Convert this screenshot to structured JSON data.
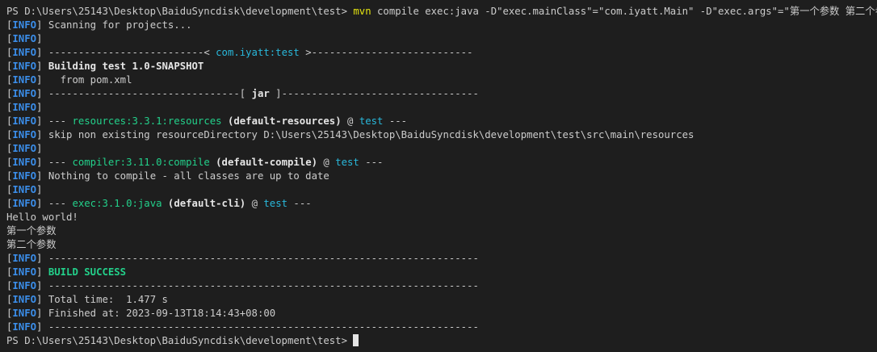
{
  "colors": {
    "background": "#1e1e1e",
    "text": "#cccccc",
    "info_tag": "#3b8eea",
    "command": "#e5e510",
    "artifact": "#29b8db",
    "plugin": "#23d18b",
    "success": "#23d18b",
    "cursor": "#e5e5e5"
  },
  "lines": [
    [
      {
        "t": "PS D:\\Users\\25143\\Desktop\\BaiduSyncdisk\\development\\test> ",
        "c": "white"
      },
      {
        "t": "mvn",
        "c": "yellow"
      },
      {
        "t": " compile exec:java -D\"exec.mainClass\"=\"com.iyatt.Main\" -D\"exec.args\"=\"第一个参数 第二个参数\"",
        "c": "white"
      }
    ],
    [
      {
        "t": "[",
        "c": "bracket"
      },
      {
        "t": "INFO",
        "c": "blue"
      },
      {
        "t": "] Scanning for projects...",
        "c": "white"
      }
    ],
    [
      {
        "t": "[",
        "c": "bracket"
      },
      {
        "t": "INFO",
        "c": "blue"
      },
      {
        "t": "]",
        "c": "white"
      }
    ],
    [
      {
        "t": "[",
        "c": "bracket"
      },
      {
        "t": "INFO",
        "c": "blue"
      },
      {
        "t": "] --------------------------< ",
        "c": "white"
      },
      {
        "t": "com.iyatt:test",
        "c": "cyan"
      },
      {
        "t": " >---------------------------",
        "c": "white"
      }
    ],
    [
      {
        "t": "[",
        "c": "bracket"
      },
      {
        "t": "INFO",
        "c": "blue"
      },
      {
        "t": "] ",
        "c": "white"
      },
      {
        "t": "Building test 1.0-SNAPSHOT",
        "c": "bold"
      }
    ],
    [
      {
        "t": "[",
        "c": "bracket"
      },
      {
        "t": "INFO",
        "c": "blue"
      },
      {
        "t": "]   from pom.xml",
        "c": "white"
      }
    ],
    [
      {
        "t": "[",
        "c": "bracket"
      },
      {
        "t": "INFO",
        "c": "blue"
      },
      {
        "t": "] --------------------------------[ ",
        "c": "white"
      },
      {
        "t": "jar",
        "c": "bold"
      },
      {
        "t": " ]---------------------------------",
        "c": "white"
      }
    ],
    [
      {
        "t": "[",
        "c": "bracket"
      },
      {
        "t": "INFO",
        "c": "blue"
      },
      {
        "t": "]",
        "c": "white"
      }
    ],
    [
      {
        "t": "[",
        "c": "bracket"
      },
      {
        "t": "INFO",
        "c": "blue"
      },
      {
        "t": "] --- ",
        "c": "white"
      },
      {
        "t": "resources:3.3.1:resources",
        "c": "green"
      },
      {
        "t": " ",
        "c": "white"
      },
      {
        "t": "(default-resources)",
        "c": "bold"
      },
      {
        "t": " @ ",
        "c": "white"
      },
      {
        "t": "test",
        "c": "cyan"
      },
      {
        "t": " ---",
        "c": "white"
      }
    ],
    [
      {
        "t": "[",
        "c": "bracket"
      },
      {
        "t": "INFO",
        "c": "blue"
      },
      {
        "t": "] skip non existing resourceDirectory D:\\Users\\25143\\Desktop\\BaiduSyncdisk\\development\\test\\src\\main\\resources",
        "c": "white"
      }
    ],
    [
      {
        "t": "[",
        "c": "bracket"
      },
      {
        "t": "INFO",
        "c": "blue"
      },
      {
        "t": "]",
        "c": "white"
      }
    ],
    [
      {
        "t": "[",
        "c": "bracket"
      },
      {
        "t": "INFO",
        "c": "blue"
      },
      {
        "t": "] --- ",
        "c": "white"
      },
      {
        "t": "compiler:3.11.0:compile",
        "c": "green"
      },
      {
        "t": " ",
        "c": "white"
      },
      {
        "t": "(default-compile)",
        "c": "bold"
      },
      {
        "t": " @ ",
        "c": "white"
      },
      {
        "t": "test",
        "c": "cyan"
      },
      {
        "t": " ---",
        "c": "white"
      }
    ],
    [
      {
        "t": "[",
        "c": "bracket"
      },
      {
        "t": "INFO",
        "c": "blue"
      },
      {
        "t": "] Nothing to compile - all classes are up to date",
        "c": "white"
      }
    ],
    [
      {
        "t": "[",
        "c": "bracket"
      },
      {
        "t": "INFO",
        "c": "blue"
      },
      {
        "t": "]",
        "c": "white"
      }
    ],
    [
      {
        "t": "[",
        "c": "bracket"
      },
      {
        "t": "INFO",
        "c": "blue"
      },
      {
        "t": "] --- ",
        "c": "white"
      },
      {
        "t": "exec:3.1.0:java",
        "c": "green"
      },
      {
        "t": " ",
        "c": "white"
      },
      {
        "t": "(default-cli)",
        "c": "bold"
      },
      {
        "t": " @ ",
        "c": "white"
      },
      {
        "t": "test",
        "c": "cyan"
      },
      {
        "t": " ---",
        "c": "white"
      }
    ],
    [
      {
        "t": "Hello world!",
        "c": "white"
      }
    ],
    [
      {
        "t": "第一个参数",
        "c": "white"
      }
    ],
    [
      {
        "t": "第二个参数",
        "c": "white"
      }
    ],
    [
      {
        "t": "[",
        "c": "bracket"
      },
      {
        "t": "INFO",
        "c": "blue"
      },
      {
        "t": "] ------------------------------------------------------------------------",
        "c": "white"
      }
    ],
    [
      {
        "t": "[",
        "c": "bracket"
      },
      {
        "t": "INFO",
        "c": "blue"
      },
      {
        "t": "] ",
        "c": "white"
      },
      {
        "t": "BUILD SUCCESS",
        "c": "greenbold"
      }
    ],
    [
      {
        "t": "[",
        "c": "bracket"
      },
      {
        "t": "INFO",
        "c": "blue"
      },
      {
        "t": "] ------------------------------------------------------------------------",
        "c": "white"
      }
    ],
    [
      {
        "t": "[",
        "c": "bracket"
      },
      {
        "t": "INFO",
        "c": "blue"
      },
      {
        "t": "] Total time:  1.477 s",
        "c": "white"
      }
    ],
    [
      {
        "t": "[",
        "c": "bracket"
      },
      {
        "t": "INFO",
        "c": "blue"
      },
      {
        "t": "] Finished at: 2023-09-13T18:14:43+08:00",
        "c": "white"
      }
    ],
    [
      {
        "t": "[",
        "c": "bracket"
      },
      {
        "t": "INFO",
        "c": "blue"
      },
      {
        "t": "] ------------------------------------------------------------------------",
        "c": "white"
      }
    ],
    [
      {
        "t": "PS D:\\Users\\25143\\Desktop\\BaiduSyncdisk\\development\\test> ",
        "c": "white"
      }
    ]
  ]
}
